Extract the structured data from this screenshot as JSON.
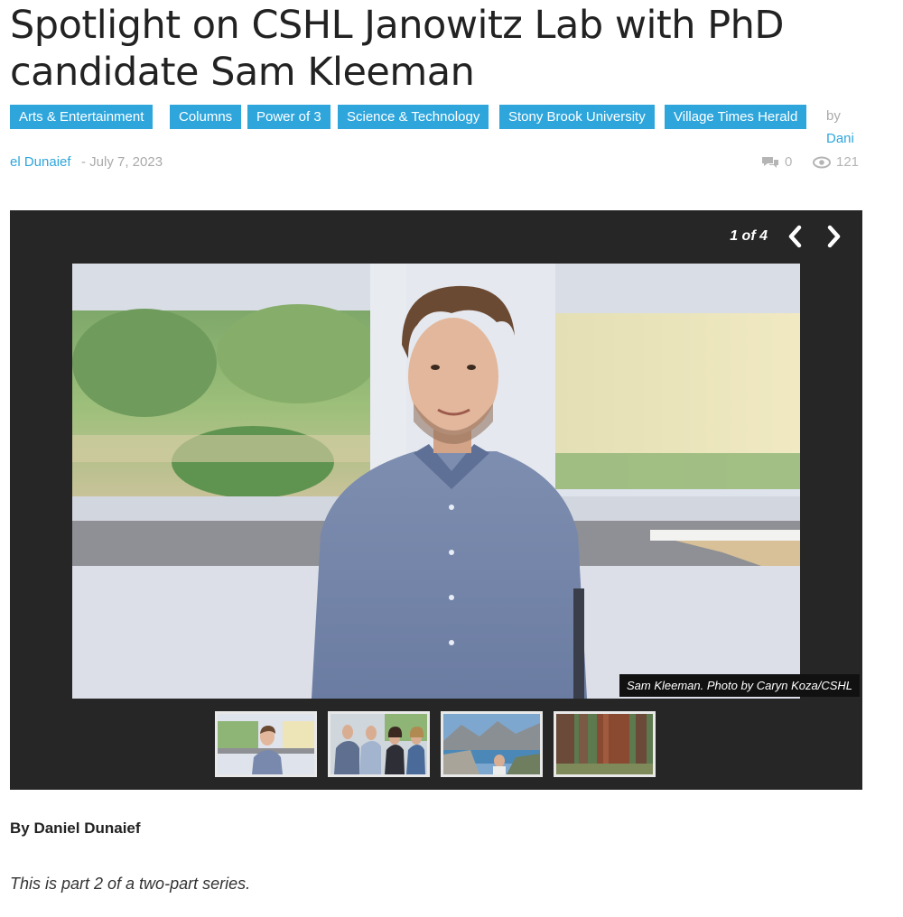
{
  "article": {
    "title": "Spotlight on CSHL Janowitz Lab with PhD candidate Sam Kleeman",
    "tags": [
      "Arts & Entertainment",
      "Columns",
      "Power of 3",
      "Science & Technology",
      "Stony Brook University",
      "Village Times Herald"
    ],
    "by_label": "by",
    "author_part1": "Dani",
    "author_part2": "el Dunaief",
    "date": "- July 7, 2023",
    "comments_count": "0",
    "views_count": "121",
    "byline": "By Daniel Dunaief",
    "intro": "This is part 2 of a two-part series."
  },
  "gallery": {
    "counter": "1 of 4",
    "caption": "Sam Kleeman. Photo by Caryn Koza/CSHL",
    "prev_icon": "chevron-left-icon",
    "next_icon": "chevron-right-icon"
  },
  "colors": {
    "accent": "#2ea6dc",
    "gallery_bg": "#262626",
    "muted": "#aaaaaa"
  }
}
